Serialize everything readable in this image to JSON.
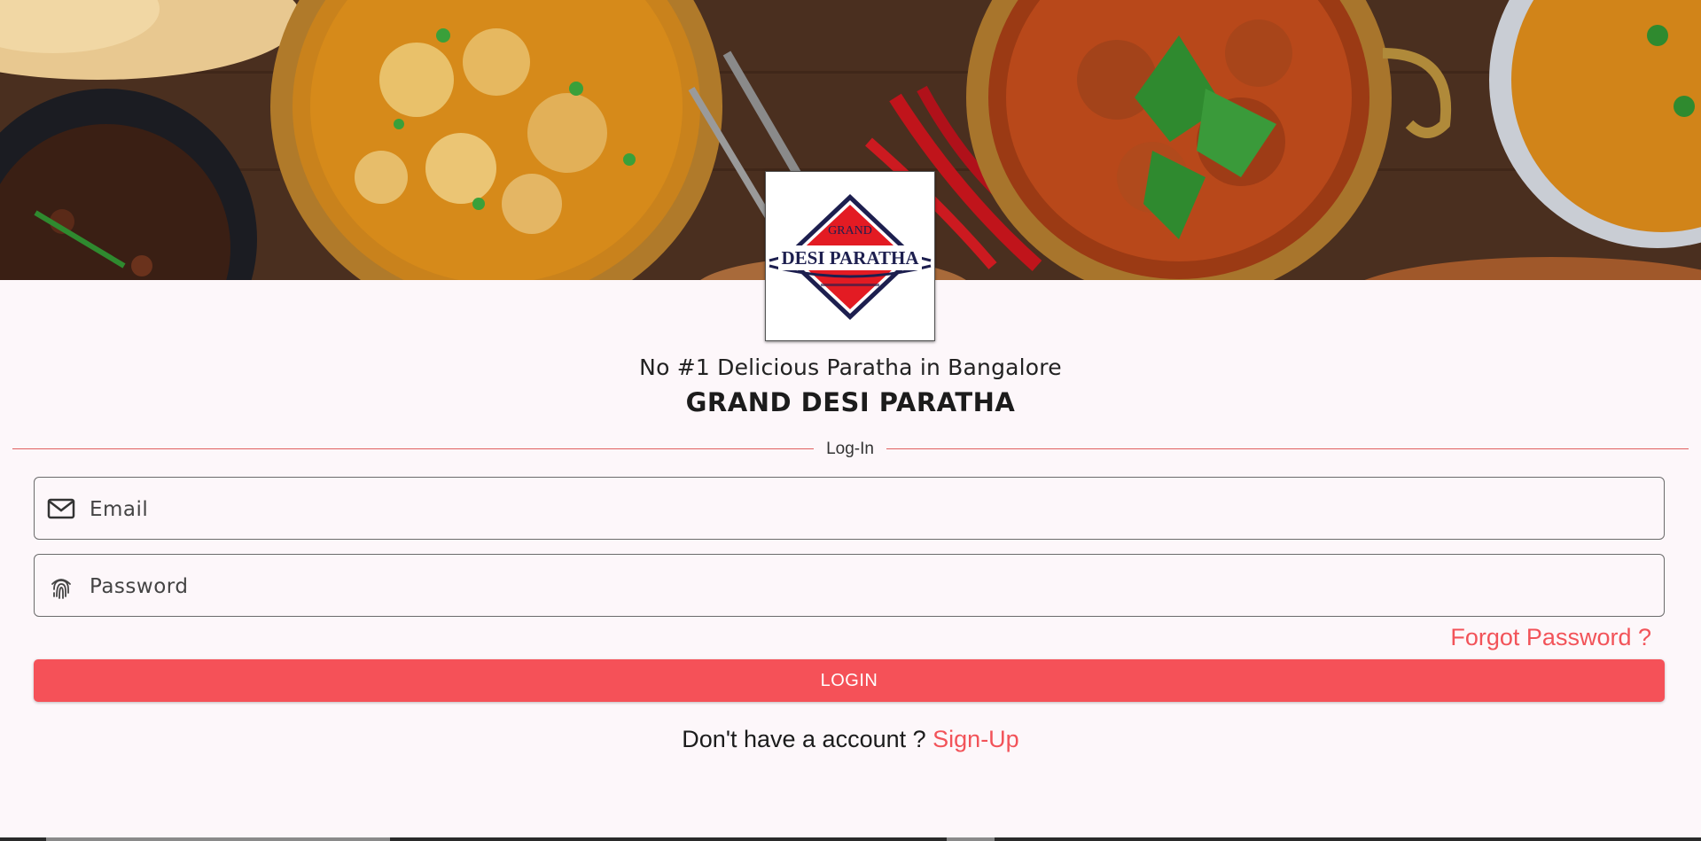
{
  "banner": {
    "alt": "Indian curry dishes banner"
  },
  "logo": {
    "line1": "GRAND",
    "line2": "DESI PARATHA",
    "colors": {
      "red": "#e31b23",
      "navy": "#1d1f4f"
    }
  },
  "header": {
    "tagline": "No #1 Delicious Paratha in Bangalore",
    "title": "GRAND DESI PARATHA"
  },
  "divider": {
    "label": "Log-In"
  },
  "form": {
    "email": {
      "placeholder": "Email",
      "value": "",
      "icon": "mail-icon"
    },
    "password": {
      "placeholder": "Password",
      "value": "",
      "icon": "fingerprint-icon"
    },
    "forgot_label": "Forgot Password ?",
    "login_label": "LOGIN"
  },
  "signup": {
    "prompt": "Don't have a account ?",
    "link_label": "Sign-Up"
  },
  "colors": {
    "accent": "#f55158",
    "link": "#f25359",
    "background": "#fdf7fa"
  }
}
